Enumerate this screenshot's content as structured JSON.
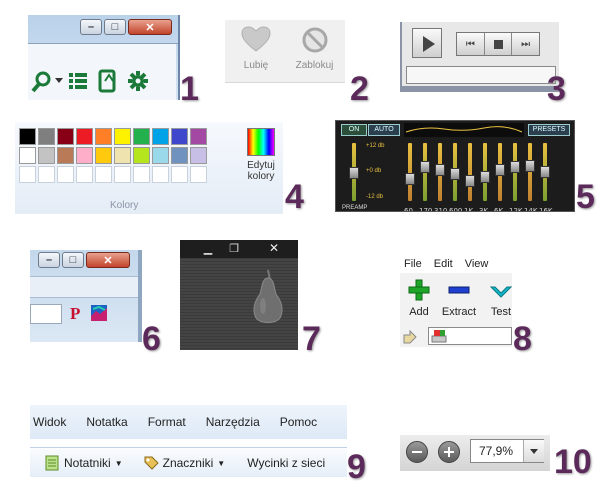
{
  "callouts": [
    "1",
    "2",
    "3",
    "4",
    "5",
    "6",
    "7",
    "8",
    "9",
    "10"
  ],
  "panel1": {
    "tools": [
      "magnifier-icon",
      "dropdown-arrow-icon",
      "list-icon",
      "device-icon",
      "gear-icon"
    ]
  },
  "panel2": {
    "like_label": "Lubię",
    "block_label": "Zablokuj"
  },
  "panel4": {
    "edit_label_line1": "Edytuj",
    "edit_label_line2": "kolory",
    "group_label": "Kolory",
    "row1": [
      "#000000",
      "#7f7f7f",
      "#880015",
      "#ed1c24",
      "#ff7f27",
      "#fff200",
      "#22b14c",
      "#00a2e8",
      "#3f48cc",
      "#a349a4"
    ],
    "row2": [
      "#ffffff",
      "#c3c3c3",
      "#b97a57",
      "#ffaec9",
      "#ffc90e",
      "#efe4b0",
      "#b5e61d",
      "#99d9ea",
      "#7092be",
      "#c8bfe7"
    ]
  },
  "panel5": {
    "on_label": "ON",
    "auto_label": "AUTO",
    "presets_label": "PRESETS",
    "db_top": "+12 db",
    "db_mid": "+0 db",
    "db_bottom": "-12 db",
    "preamp_label": "PREAMP",
    "bands": [
      "60",
      "170",
      "310",
      "600",
      "1K",
      "3K",
      "6K",
      "12K",
      "14K",
      "16K"
    ],
    "levels": [
      0.35,
      0.6,
      0.55,
      0.45,
      0.3,
      0.4,
      0.55,
      0.6,
      0.62,
      0.5
    ]
  },
  "panel6": {
    "p_icon": "P"
  },
  "panel8": {
    "menu": [
      "File",
      "Edit",
      "View"
    ],
    "add_label": "Add",
    "extract_label": "Extract",
    "test_label": "Test"
  },
  "panel9": {
    "menu": [
      "Widok",
      "Notatka",
      "Format",
      "Narzędzia",
      "Pomoc"
    ],
    "notebooks_label": "Notatniki",
    "tags_label": "Znaczniki",
    "clips_label": "Wycinki z sieci"
  },
  "panel10": {
    "zoom_value": "77,9%"
  }
}
